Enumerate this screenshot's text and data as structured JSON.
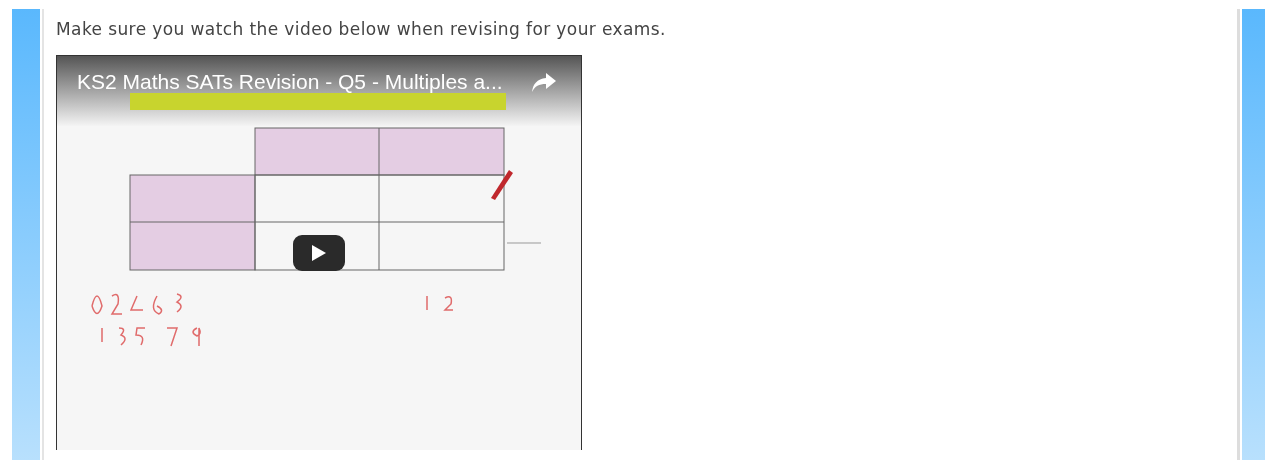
{
  "intro": "Make sure you watch the video below when revising for your exams.",
  "video": {
    "title": "KS2 Maths SATs Revision - Q5 - Multiples a...",
    "kind": "picture"
  }
}
